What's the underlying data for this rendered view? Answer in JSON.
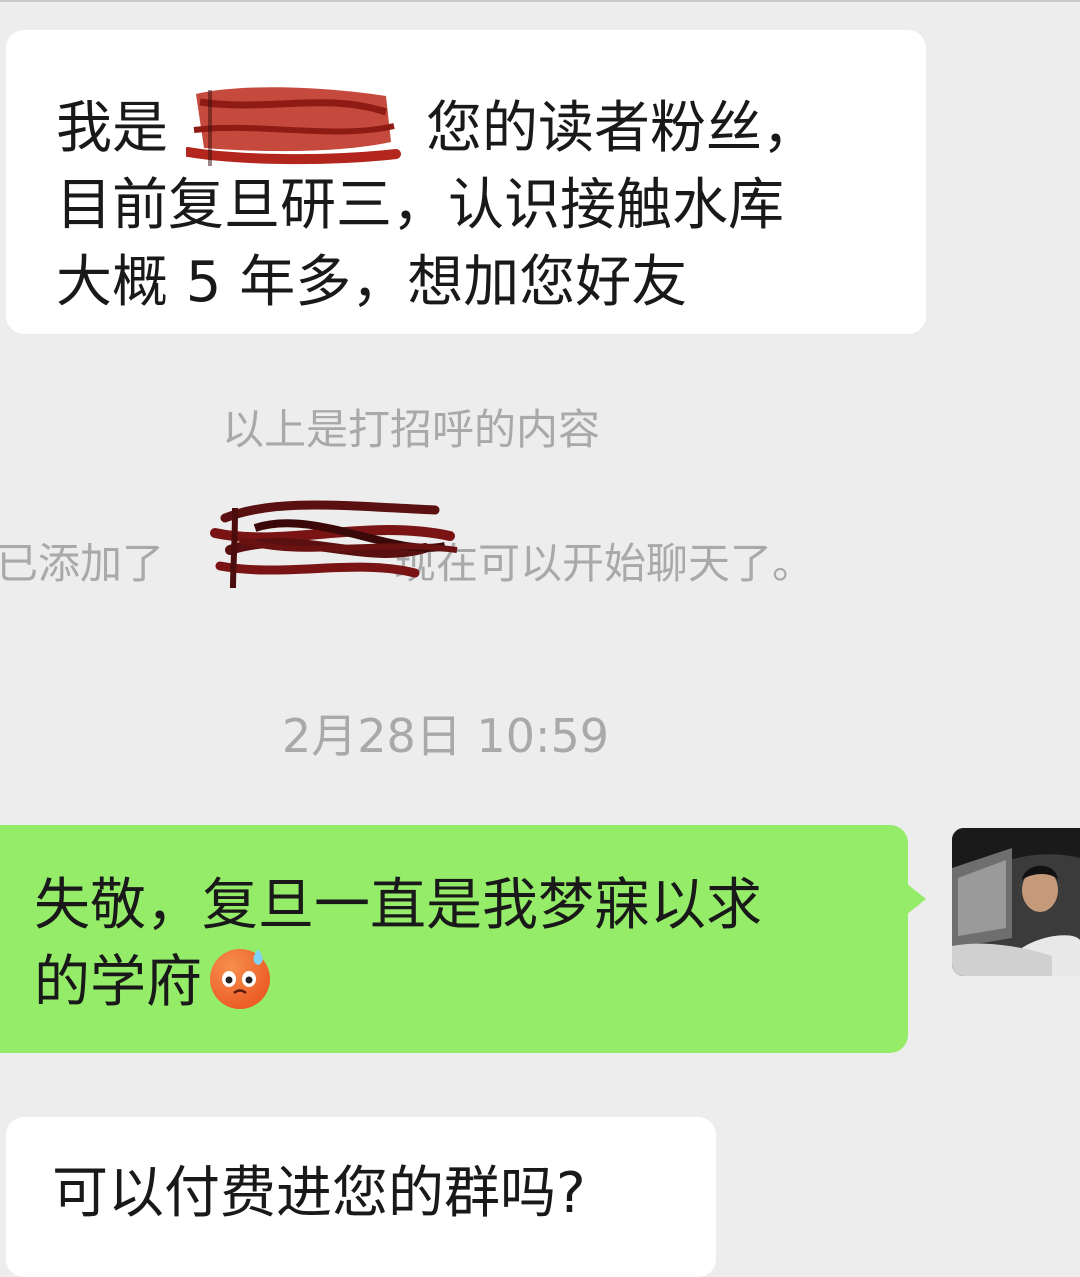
{
  "messages": {
    "greeting": {
      "line1_prefix": "我是",
      "line1_suffix": "您的读者粉丝，",
      "line2": "目前复旦研三，认识接触水库",
      "line3": "大概 5 年多，想加您好友"
    },
    "reply": {
      "line1": "失敬，复旦一直是我梦寐以求",
      "line2": "的学府",
      "emoji": "cold-sweat-emoji"
    },
    "question": {
      "text": "可以付费进您的群吗?"
    }
  },
  "system": {
    "greeting_note": "以上是打招呼的内容",
    "added_prefix": "已添加了",
    "added_suffix": "现在可以开始聊天了。",
    "timestamp": "2月28日 10:59"
  },
  "colors": {
    "background": "#ededed",
    "incoming_bubble": "#ffffff",
    "outgoing_bubble": "#95ec69",
    "system_text": "#a9a9a9",
    "scribble": "#b3261e"
  }
}
